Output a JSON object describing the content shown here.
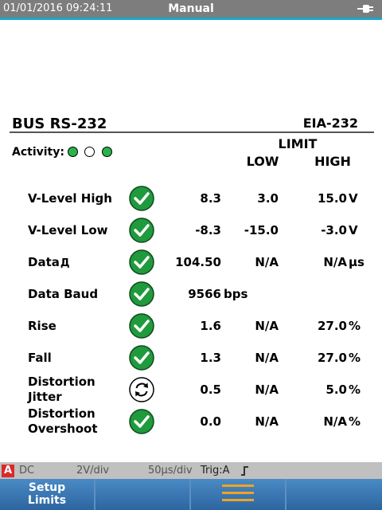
{
  "status_bar": {
    "datetime": "01/01/2016 09:24:11",
    "mode": "Manual",
    "icon": "power-plug-icon"
  },
  "header": {
    "bus": "BUS RS-232",
    "standard": "EIA-232",
    "activity_label": "Activity:",
    "activity_dots": [
      "on",
      "off",
      "on"
    ],
    "limit_label": "LIMIT",
    "low_label": "LOW",
    "high_label": "HIGH"
  },
  "rows": [
    {
      "label": "V-Level High",
      "status": "pass",
      "value": "8.3",
      "low": "3.0",
      "high": "15.0",
      "unit": "V"
    },
    {
      "label": "V-Level Low",
      "status": "pass",
      "value": "-8.3",
      "low": "-15.0",
      "high": "-3.0",
      "unit": "V"
    },
    {
      "label": "Data",
      "label_suffix": "Д",
      "status": "pass",
      "value": "104.50",
      "low": "N/A",
      "high": "N/A",
      "unit": "µs"
    },
    {
      "label": "Data Baud",
      "status": "pass",
      "value": "9566",
      "value_unit": "bps"
    },
    {
      "label": "Rise",
      "status": "pass",
      "value": "1.6",
      "low": "N/A",
      "high": "27.0",
      "unit": "%"
    },
    {
      "label": "Fall",
      "status": "pass",
      "value": "1.3",
      "low": "N/A",
      "high": "27.0",
      "unit": "%"
    },
    {
      "label": "Distortion",
      "label2": "Jitter",
      "status": "pending",
      "value": "0.5",
      "low": "N/A",
      "high": "5.0",
      "unit": "%"
    },
    {
      "label": "Distortion",
      "label2": "Overshoot",
      "status": "pass",
      "value": "0.0",
      "low": "N/A",
      "high": "N/A",
      "unit": "%"
    }
  ],
  "bottom_status": {
    "channel": "A",
    "coupling": "DC",
    "volts_div": "2V/div",
    "time_div": "50µs/div",
    "trigger": "Trig:A",
    "trigger_slope_icon": "rising-edge-icon"
  },
  "softkeys": {
    "key1_line1": "Setup",
    "key1_line2": "Limits",
    "menu_icon": "menu-icon"
  },
  "colors": {
    "pass_green": "#1f9a3c",
    "accent_blue": "#17a7c9",
    "softkey_blue": "#2e6fa6",
    "menu_orange": "#f0a323",
    "channel_red": "#d92a2a"
  }
}
